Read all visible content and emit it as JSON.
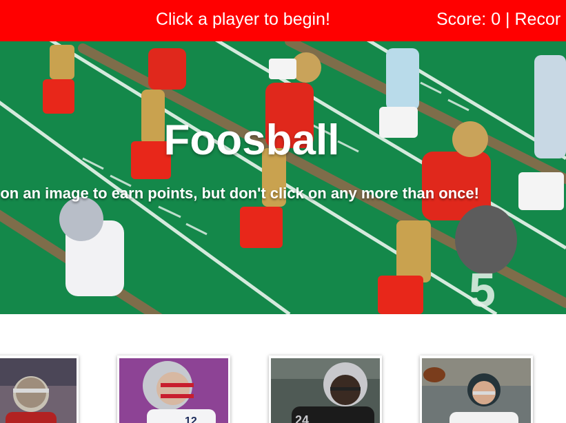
{
  "navbar": {
    "message": "Click a player to begin!",
    "score_text": "Score: 0 | Recor"
  },
  "hero": {
    "title": "Foosball",
    "subtitle": "k on an image to earn points, but don't click on any more than once!"
  },
  "colors": {
    "navbar_bg": "#ff0000",
    "field_green": "#148a4f"
  },
  "cards": [
    {
      "icon": "player-49ers-image"
    },
    {
      "icon": "player-patriots-image"
    },
    {
      "icon": "player-raiders-image"
    },
    {
      "icon": "player-eagles-image"
    }
  ]
}
